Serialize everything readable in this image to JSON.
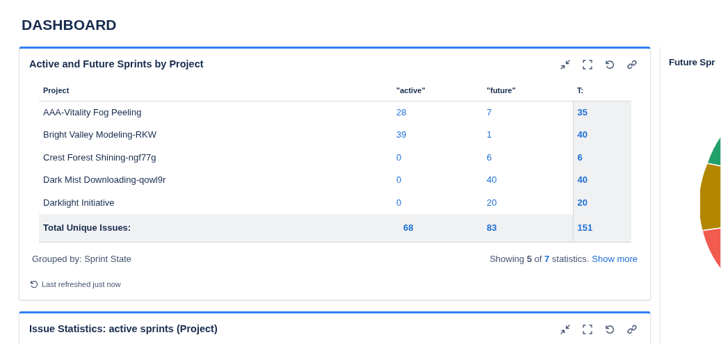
{
  "page_title": "DASHBOARD",
  "gadgets": [
    {
      "title": "Active and Future Sprints by Project",
      "table": {
        "columns": [
          "Project",
          "\"active\"",
          "\"future\"",
          "T:"
        ],
        "rows": [
          {
            "project": "AAA-Vitality Fog Peeling",
            "active": "28",
            "future": "7",
            "total": "35"
          },
          {
            "project": "Bright Valley Modeling-RKW",
            "active": "39",
            "future": "1",
            "total": "40"
          },
          {
            "project": "Crest Forest Shining-ngf77g",
            "active": "0",
            "future": "6",
            "total": "6"
          },
          {
            "project": "Dark Mist Downloading-qowl9r",
            "active": "0",
            "future": "40",
            "total": "40"
          },
          {
            "project": "Darklight Initiative",
            "active": "0",
            "future": "20",
            "total": "20"
          }
        ],
        "totals": {
          "label": "Total Unique Issues:",
          "active": "68",
          "future": "83",
          "total": "151"
        }
      },
      "grouped_by": "Grouped by: Sprint State",
      "showing": "Showing **5** of **7** statistics.",
      "show_more": "Show more",
      "refreshed": "Last refreshed just now"
    },
    {
      "title": "Issue Statistics: active sprints (Project)"
    }
  ],
  "side_gadget": {
    "title": "Future Spr"
  }
}
